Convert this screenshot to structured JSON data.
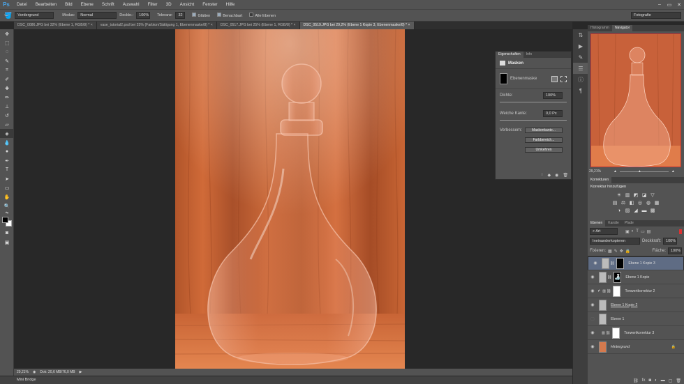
{
  "app": {
    "logo": "Ps"
  },
  "menu": [
    "Datei",
    "Bearbeiten",
    "Bild",
    "Ebene",
    "Schrift",
    "Auswahl",
    "Filter",
    "3D",
    "Ansicht",
    "Fenster",
    "Hilfe"
  ],
  "window_controls": [
    "–",
    "▭",
    "✕"
  ],
  "options": {
    "tool_preset": "Vordergrund",
    "mode_label": "Modus:",
    "mode_value": "Normal",
    "opacity_label": "Deckkr.:",
    "opacity_value": "100%",
    "tolerance_label": "Toleranz:",
    "tolerance_value": "32",
    "antialias": "Glätten",
    "contiguous": "Benachbart",
    "all_layers": "Alle Ebenen",
    "workspace": "Fotografie"
  },
  "tabs": [
    {
      "label": "DSC_0086.JPG bei 32% (Ebene 1, RGB/8) *",
      "close": "×"
    },
    {
      "label": "vase_tutorial2.psd bei 25% (Farbton/Sättigung 1, Ebenenmaske/8) *",
      "close": "×"
    },
    {
      "label": "DSC_0517.JPG bei 25% (Ebene 1, RGB/8) *",
      "close": "×"
    },
    {
      "label": "DSC_0519.JPG bei 29,2% (Ebene 1 Kopie 3, Ebenenmaske/8) *",
      "close": "×"
    }
  ],
  "status": {
    "zoom": "29,21%",
    "doc": "Dok: 20,6 MB/76,0 MB",
    "arrow": "▶"
  },
  "minibridge": "Mini Bridge",
  "properties": {
    "tabs": [
      "Eigenschaften",
      "Info"
    ],
    "header": "Masken",
    "mask_type": "Ebenenmaske",
    "density_label": "Dichte:",
    "density_value": "100%",
    "feather_label": "Weiche Kante:",
    "feather_value": "0,0 Px",
    "refine_label": "Verbessern:",
    "btn_edge": "Maskenkante...",
    "btn_color": "Farbbereich...",
    "btn_invert": "Umkehren"
  },
  "navigator": {
    "tabs": [
      "Histogramm",
      "Navigator"
    ],
    "zoom": "29,21%"
  },
  "corrections": {
    "tabs": [
      "Korrekturen"
    ],
    "title": "Korrektur hinzufügen"
  },
  "layers_panel": {
    "tabs": [
      "Ebenen",
      "Kanäle",
      "Pfade"
    ],
    "filter": "Art",
    "blend": "Ineinanderkopieren",
    "opacity_label": "Deckkraft:",
    "opacity_value": "100%",
    "lock_label": "Fixieren:",
    "fill_label": "Fläche:",
    "fill_value": "100%",
    "layers": [
      {
        "name": "Ebene 1 Kopie 3",
        "mask": "black",
        "selected": true
      },
      {
        "name": "Ebene 1 Kopie",
        "mask": "bottle",
        "selected": false
      },
      {
        "name": "Tonwertkorrektur 2",
        "mask": "white",
        "adjust": true,
        "selected": false
      },
      {
        "name": "Ebene 1 Kopie 2",
        "mask": "none",
        "selected": false
      },
      {
        "name": "Ebene 1",
        "mask": "none",
        "selected": false
      },
      {
        "name": "Tonwertkorrektur 3",
        "mask": "white",
        "adjust": true,
        "selected": false
      },
      {
        "name": "Hintergrund",
        "mask": "none",
        "background": true,
        "selected": false
      }
    ]
  }
}
